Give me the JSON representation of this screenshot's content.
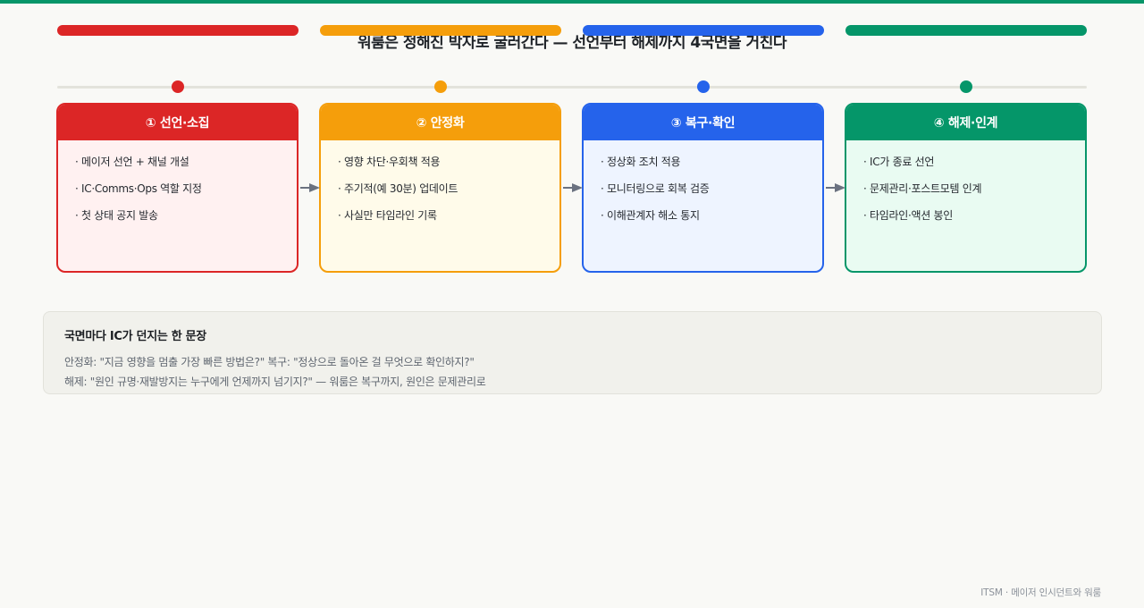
{
  "title": "워룸은 정해진 박자로 굴러간다 — 선언부터 해제까지 4국면을 거친다",
  "phases": [
    {
      "header": "① 선언·소집",
      "color": "#dc2626",
      "bg": "#fff1f1",
      "items": [
        "· 메이저 선언 + 채널 개설",
        "· IC·Comms·Ops 역할 지정",
        "· 첫 상태 공지 발송"
      ]
    },
    {
      "header": "② 안정화",
      "color": "#f59e0b",
      "bg": "#fffbea",
      "items": [
        "· 영향 차단·우회책 적용",
        "· 주기적(예 30분) 업데이트",
        "· 사실만 타임라인 기록"
      ]
    },
    {
      "header": "③ 복구·확인",
      "color": "#2563eb",
      "bg": "#eef4ff",
      "items": [
        "· 정상화 조치 적용",
        "· 모니터링으로 회복 검증",
        "· 이해관계자 해소 통지"
      ]
    },
    {
      "header": "④ 해제·인계",
      "color": "#059669",
      "bg": "#e9fbf2",
      "items": [
        "· IC가 종료 선언",
        "· 문제관리·포스트모템 인계",
        "· 타임라인·액션 봉인"
      ]
    }
  ],
  "note": {
    "title": "국면마다 IC가 던지는 한 문장",
    "line1": "안정화: \"지금 영향을 멈출 가장 빠른 방법은?\" 복구: \"정상으로 돌아온 걸 무엇으로 확인하지?\"",
    "line2": "해제: \"원인 규명·재발방지는 누구에게 언제까지 넘기지?\" — 워룸은 복구까지, 원인은 문제관리로"
  },
  "footer": "ITSM · 메이저 인시던트와 워룸",
  "colors": {
    "top_rule": "#079669",
    "arrow": "#6b7280"
  }
}
